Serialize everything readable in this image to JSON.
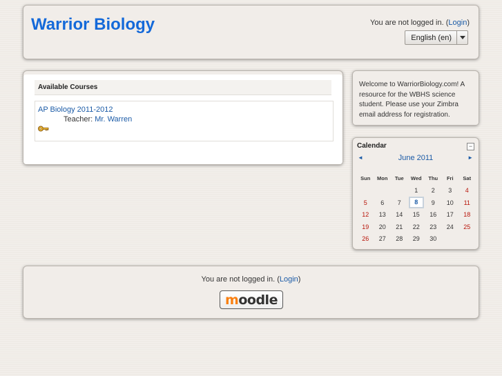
{
  "header": {
    "site_title": "Warrior Biology",
    "login_prefix": "You are not logged in. (",
    "login_link": "Login",
    "login_suffix": ")",
    "language": "English (en)"
  },
  "courses_block": {
    "title": "Available Courses",
    "course_name": "AP Biology 2011-2012",
    "teacher_label": "Teacher: ",
    "teacher_name": "Mr. Warren",
    "icons": {
      "enrol": "key-icon"
    }
  },
  "welcome_block": {
    "text": "Welcome to WarriorBiology.com! A resource for the WBHS science student. Please use your Zimbra email address for registration."
  },
  "calendar": {
    "title": "Calendar",
    "collapse_symbol": "−",
    "prev": "◄",
    "next": "►",
    "month": "June 2011",
    "weekdays": [
      "Sun",
      "Mon",
      "Tue",
      "Wed",
      "Thu",
      "Fri",
      "Sat"
    ],
    "weeks": [
      [
        "",
        "",
        "",
        "1",
        "2",
        "3",
        "4"
      ],
      [
        "5",
        "6",
        "7",
        "8",
        "9",
        "10",
        "11"
      ],
      [
        "12",
        "13",
        "14",
        "15",
        "16",
        "17",
        "18"
      ],
      [
        "19",
        "20",
        "21",
        "22",
        "23",
        "24",
        "25"
      ],
      [
        "26",
        "27",
        "28",
        "29",
        "30",
        "",
        ""
      ]
    ],
    "today": "8",
    "colors": {
      "weekend": "#b8150a",
      "link": "#1a5aa6"
    }
  },
  "footer": {
    "login_prefix": "You are not logged in. (",
    "login_link": "Login",
    "login_suffix": ")",
    "logo_text": "moodle",
    "logo_first_letter": "m",
    "logo_rest": "oodle"
  },
  "colors": {
    "title_blue": "#1469d9",
    "panel_bg": "#f1ede9",
    "page_bg": "#efebe6"
  }
}
